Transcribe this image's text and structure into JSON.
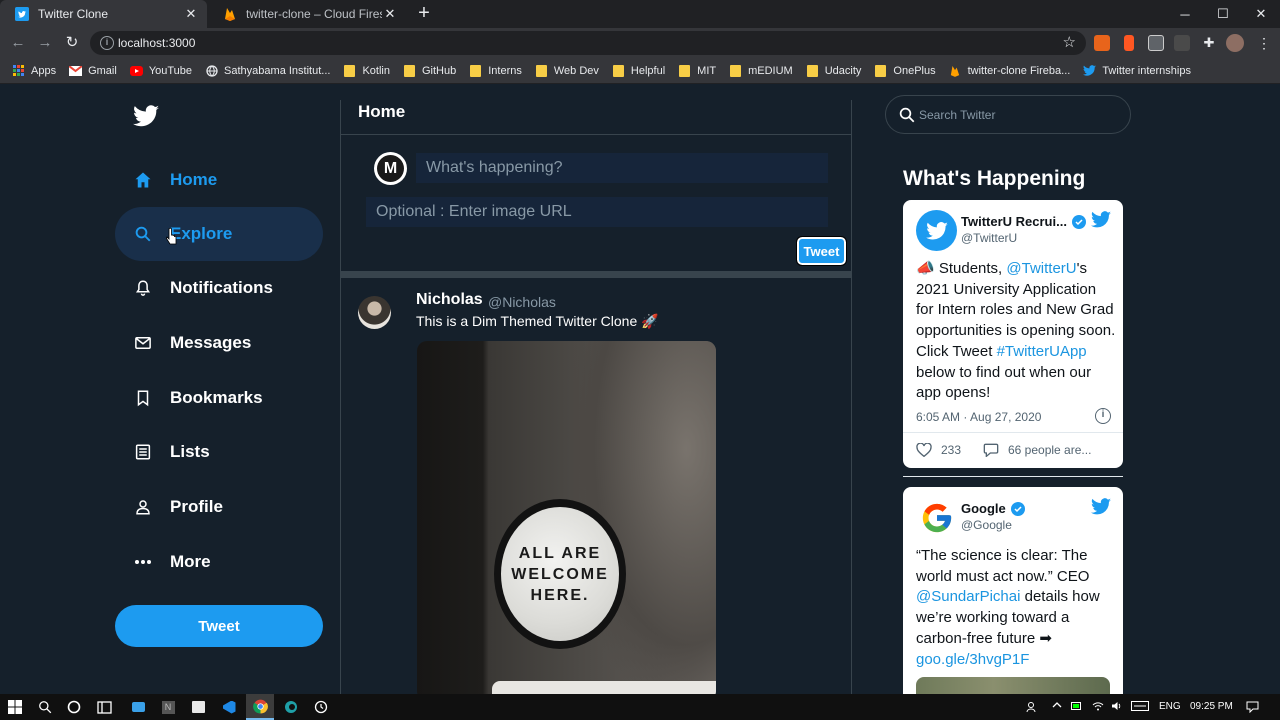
{
  "browser": {
    "tabs": [
      {
        "title": "Twitter Clone",
        "active": true,
        "favicon": "twitter-bird-icon"
      },
      {
        "title": "twitter-clone – Cloud Firestore –",
        "active": false,
        "favicon": "firebase-icon"
      }
    ],
    "new_tab_symbol": "+",
    "url": "localhost:3000",
    "bookmarks": [
      {
        "label": "Apps",
        "icon": "apps-grid-icon"
      },
      {
        "label": "Gmail",
        "icon": "gmail-icon"
      },
      {
        "label": "YouTube",
        "icon": "youtube-icon"
      },
      {
        "label": "Sathyabama Institut...",
        "icon": "globe-icon"
      },
      {
        "label": "Kotlin",
        "icon": "folder-icon"
      },
      {
        "label": "GitHub",
        "icon": "folder-icon"
      },
      {
        "label": "Interns",
        "icon": "folder-icon"
      },
      {
        "label": "Web Dev",
        "icon": "folder-icon"
      },
      {
        "label": "Helpful",
        "icon": "folder-icon"
      },
      {
        "label": "MIT",
        "icon": "folder-icon"
      },
      {
        "label": "mEDIUM",
        "icon": "folder-icon"
      },
      {
        "label": "Udacity",
        "icon": "folder-icon"
      },
      {
        "label": "OnePlus",
        "icon": "folder-icon"
      },
      {
        "label": "twitter-clone Fireba...",
        "icon": "firebase-icon"
      },
      {
        "label": "Twitter internships",
        "icon": "twitter-bird-icon"
      }
    ]
  },
  "sidebar": {
    "items": [
      {
        "label": "Home",
        "icon": "home-icon"
      },
      {
        "label": "Explore",
        "icon": "search-icon"
      },
      {
        "label": "Notifications",
        "icon": "bell-icon"
      },
      {
        "label": "Messages",
        "icon": "mail-icon"
      },
      {
        "label": "Bookmarks",
        "icon": "bookmark-icon"
      },
      {
        "label": "Lists",
        "icon": "list-icon"
      },
      {
        "label": "Profile",
        "icon": "person-icon"
      },
      {
        "label": "More",
        "icon": "more-dots-icon"
      }
    ],
    "tweet_button": "Tweet"
  },
  "feed": {
    "title": "Home",
    "composer": {
      "placeholder": "What's happening?",
      "image_placeholder": "Optional : Enter image URL",
      "button": "Tweet",
      "avatar_letter": "M"
    },
    "post": {
      "display_name": "Nicholas",
      "handle": "@Nicholas",
      "text": "This is a Dim Themed Twitter Clone 🚀",
      "image_text": [
        "ALL ARE",
        "WELCOME",
        "HERE."
      ]
    }
  },
  "widgets": {
    "search_placeholder": "Search Twitter",
    "heading": "What's Happening",
    "cards": [
      {
        "name": "TwitterU Recrui...",
        "handle": "@TwitterU",
        "body_parts": [
          {
            "t": "📣 Students, ",
            "link": false
          },
          {
            "t": "@TwitterU",
            "link": true
          },
          {
            "t": "'s 2021 University Application for Intern roles and New Grad opportunities is opening soon. Click Tweet ",
            "link": false
          },
          {
            "t": "#TwitterUApp",
            "link": true
          },
          {
            "t": " below to find out when our app opens!",
            "link": false
          }
        ],
        "timestamp": "6:05 AM · Aug 27, 2020",
        "likes": "233",
        "replies": "66 people are..."
      },
      {
        "name": "Google",
        "handle": "@Google",
        "body_parts": [
          {
            "t": "“The science is clear: The world must act now.” CEO ",
            "link": false
          },
          {
            "t": "@SundarPichai",
            "link": true
          },
          {
            "t": " details how we’re working toward a carbon-free future ➡ ",
            "link": false
          },
          {
            "t": "goo.gle/3hvgP1F",
            "link": true
          }
        ]
      }
    ]
  },
  "taskbar": {
    "language": "ENG",
    "time": "09:25 PM"
  },
  "colors": {
    "background": "#15202b",
    "accent": "#1d9bf0",
    "border": "#38444d",
    "muted": "#8899a6"
  }
}
